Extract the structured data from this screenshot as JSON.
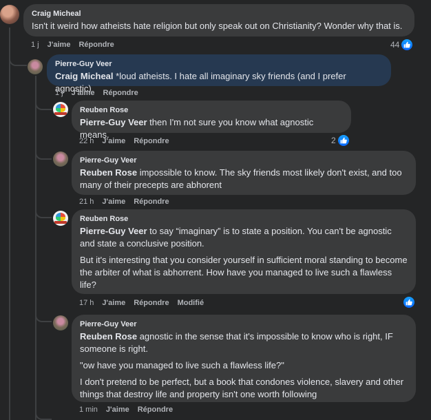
{
  "comments": [
    {
      "author": "Craig Micheal",
      "text": "Isn't it weird how atheists hate religion but only speak out on Christianity? Wonder why that is.",
      "time": "1 j",
      "like": "J'aime",
      "reply": "Répondre",
      "reactions": "44"
    },
    {
      "author": "Pierre-Guy Veer",
      "mention": "Craig Micheal",
      "text": " *loud atheists. I hate all imaginary sky friends (and I prefer agnostic)",
      "time": "1 j",
      "like": "J'aime",
      "reply": "Répondre"
    },
    {
      "author": "Reuben Rose",
      "mention": "Pierre-Guy Veer",
      "text": " then I'm not sure you know what agnostic means.",
      "time": "22 h",
      "like": "J'aime",
      "reply": "Répondre",
      "reactions": "2"
    },
    {
      "author": "Pierre-Guy Veer",
      "mention": "Reuben Rose",
      "text": " impossible to know. The sky friends most likely don't exist, and too many of their precepts are abhorent",
      "time": "21 h",
      "like": "J'aime",
      "reply": "Répondre"
    },
    {
      "author": "Reuben Rose",
      "mention": "Pierre-Guy Veer",
      "text": " to say “imaginary” is to state a position. You can't be agnostic and state a conclusive position.",
      "para2": "But it's interesting that you consider yourself in sufficient moral standing to become the arbiter of what is abhorrent. How have you managed to live such a flawless life?",
      "time": "17 h",
      "like": "J'aime",
      "reply": "Répondre",
      "edited": "Modifié"
    },
    {
      "author": "Pierre-Guy Veer",
      "mention": "Reuben Rose",
      "text": " agnostic in the sense that it's impossible to know who is right, IF someone is right.",
      "para2": "\"ow have you managed to live such a flawless life?\"",
      "para3": "I don't pretend to be perfect, but a book that condones violence, slavery and other things that destroy life and property isn't one worth following",
      "time": "1 min",
      "like": "J'aime",
      "reply": "Répondre"
    }
  ],
  "icons": {
    "like": "thumbs-up-icon"
  },
  "colors": {
    "like_blue": "#0866ff",
    "highlight": "#263951",
    "bubble": "#3a3b3c"
  }
}
